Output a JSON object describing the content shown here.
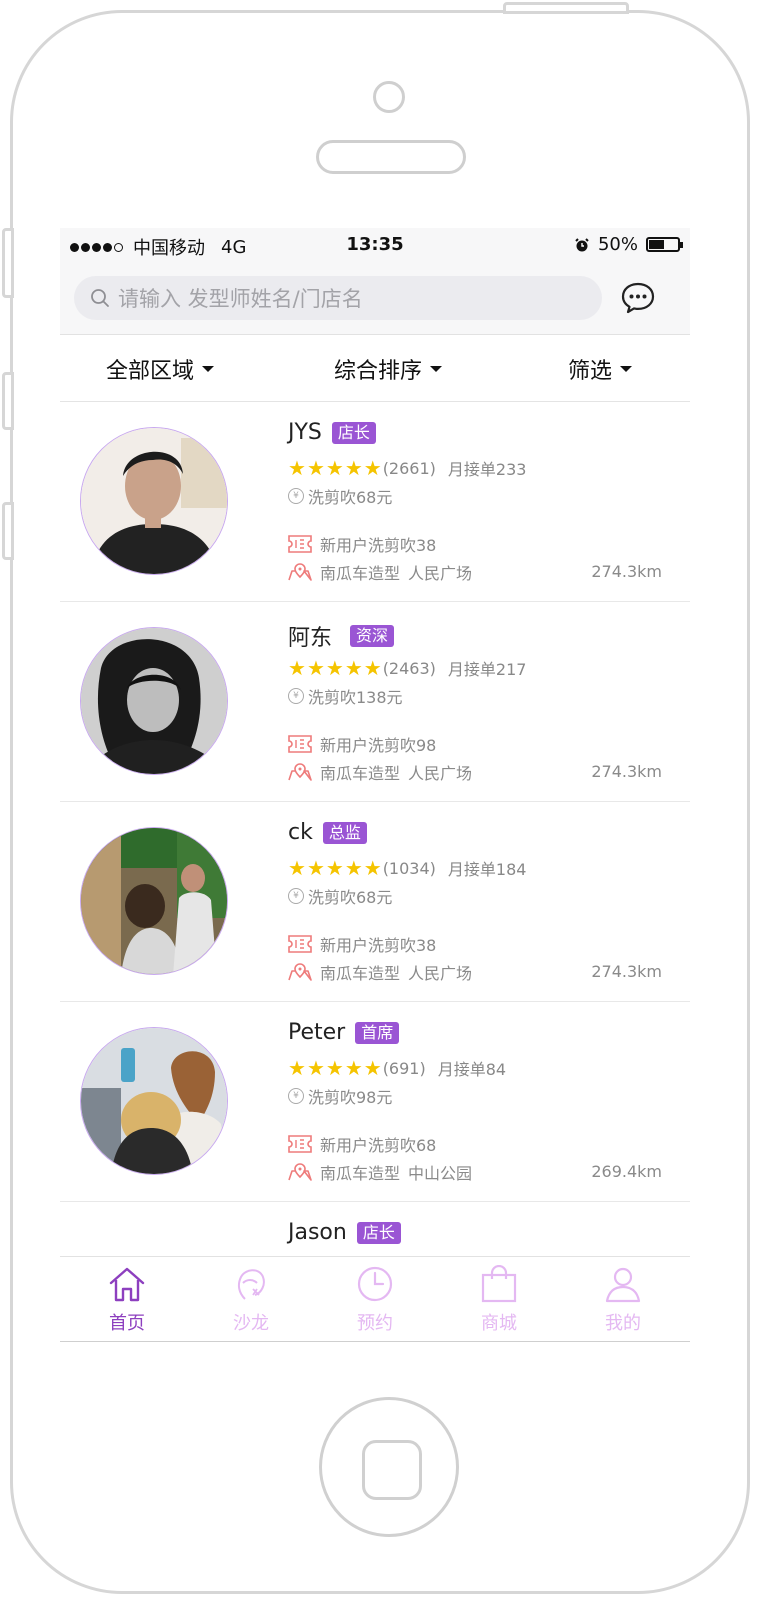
{
  "status_bar": {
    "carrier": "中国移动",
    "network": "4G",
    "time": "13:35",
    "battery": "50%",
    "battery_level": 0.5
  },
  "search": {
    "placeholder": "请输入 发型师姓名/门店名"
  },
  "filters": {
    "area": "全部区域",
    "sort": "综合排序",
    "filter": "筛选"
  },
  "stylists": [
    {
      "name": "JYS",
      "badge": "店长",
      "reviews": "(2661)",
      "monthly": "月接单233",
      "price": "洗剪吹68元",
      "promo": "新用户洗剪吹38",
      "salon": "南瓜车造型",
      "area": "人民广场",
      "distance": "274.3km",
      "stars": 5
    },
    {
      "name": "阿东",
      "badge": "资深",
      "reviews": "(2463)",
      "monthly": "月接单217",
      "price": "洗剪吹138元",
      "promo": "新用户洗剪吹98",
      "salon": "南瓜车造型",
      "area": "人民广场",
      "distance": "274.3km",
      "stars": 5
    },
    {
      "name": "ck",
      "badge": "总监",
      "reviews": "(1034)",
      "monthly": "月接单184",
      "price": "洗剪吹68元",
      "promo": "新用户洗剪吹38",
      "salon": "南瓜车造型",
      "area": "人民广场",
      "distance": "274.3km",
      "stars": 5
    },
    {
      "name": "Peter",
      "badge": "首席",
      "reviews": "(691)",
      "monthly": "月接单84",
      "price": "洗剪吹98元",
      "promo": "新用户洗剪吹68",
      "salon": "南瓜车造型",
      "area": "中山公园",
      "distance": "269.4km",
      "stars": 5
    },
    {
      "name": "Jason",
      "badge": "店长"
    }
  ],
  "tabbar": {
    "home": "首页",
    "salon": "沙龙",
    "booking": "预约",
    "mall": "商城",
    "mine": "我的"
  },
  "colors": {
    "accent": "#9a55d4",
    "tab_active": "#8d3fbf",
    "tab_inactive": "#e4b8f2",
    "star": "#f5c400",
    "promo_icon": "#ee7b7b"
  }
}
